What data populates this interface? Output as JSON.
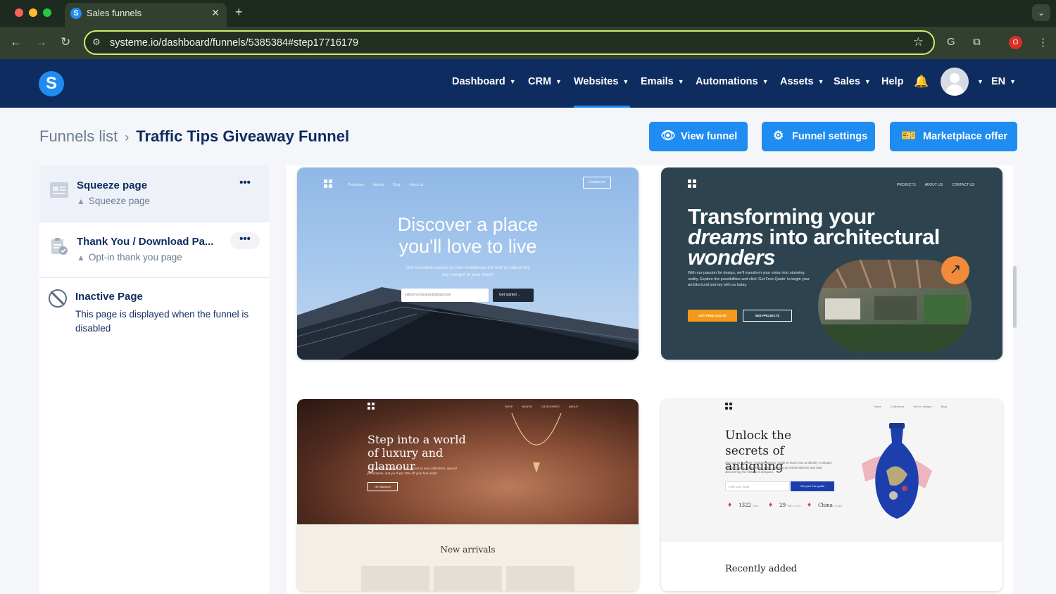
{
  "browser": {
    "tab_title": "Sales funnels",
    "new_tab": "+",
    "tab_close": "✕",
    "url": "systeme.io/dashboard/funnels/5385384#step17716179",
    "profile_badge": "O"
  },
  "app": {
    "logo_letter": "S",
    "nav": [
      {
        "label": "Dashboard",
        "active": false
      },
      {
        "label": "CRM",
        "active": false
      },
      {
        "label": "Websites",
        "active": true
      },
      {
        "label": "Emails",
        "active": false
      },
      {
        "label": "Automations",
        "active": false
      },
      {
        "label": "Assets",
        "active": false
      },
      {
        "label": "Sales",
        "active": false
      },
      {
        "label": "Help",
        "active": false
      }
    ],
    "language": "EN",
    "accent_color": "#1e8cf0",
    "header_color": "#0e2c5f"
  },
  "page": {
    "breadcrumb_parent": "Funnels list",
    "breadcrumb_current": "Traffic Tips Giveaway Funnel",
    "buttons": {
      "view_funnel": "View funnel",
      "funnel_settings": "Funnel settings",
      "marketplace_offer": "Marketplace offer"
    }
  },
  "steps": [
    {
      "title": "Squeeze page",
      "subtitle": "Squeeze page",
      "more": "•••",
      "active": true
    },
    {
      "title": "Thank You / Download Pa...",
      "subtitle": "Opt-in thank you page",
      "more": "•••",
      "active": false
    }
  ],
  "inactive_page": {
    "title": "Inactive Page",
    "description": "This page is displayed when the funnel is disabled"
  },
  "templates": [
    {
      "nav": [
        "Properties",
        "Agents",
        "Blog",
        "About us"
      ],
      "contact": "Contact us",
      "headline": "Discover a place you'll love to live",
      "sub": "Get exclusive access to new residences for rent or sale,every day straight to your inbox!",
      "email_placeholder": "valkoxni.missbay@gmail.com",
      "cta": "Get started →"
    },
    {
      "nav": [
        "PROJECTS",
        "ABOUT US",
        "CONTACT US"
      ],
      "headline_1": "Transforming your",
      "headline_2_em": "dreams",
      "headline_2": " into architectural",
      "headline_3_em": "wonders",
      "para": "With our passion for design, we'll transform your vision into stunning reality. Explore the possibilities and click 'Get Free Quote' to begin your architectural journey with us today.",
      "cta_1": "GET FREE QUOTE",
      "cta_2": "SEE PROJECTS",
      "arrow": "↗"
    },
    {
      "nav": [
        "SHOP",
        "NEW IN",
        "CATEGORIES",
        "ABOUT"
      ],
      "headline": "Step into a world of luxury and glamour",
      "sub": "Join our VIP email list for first access to new collections, special promotions, and you'll get 20% off your first order!",
      "cta": "Get discount",
      "section": "New arrivals"
    },
    {
      "nav": [
        "Home",
        "Collections",
        "Sell an antique",
        "Blog"
      ],
      "headline": "Unlock the secrets of antiquing",
      "sub": "Sign up for our free \"Antique Buying\" guide to learn how to identify, evaluate, and purchase antiques like a pro. Leave your email address and start discovering the history of antiques.",
      "email_placeholder": "Enter your email",
      "cta": "Get your free guide",
      "stats": [
        {
          "value": "1322",
          "label": "Year"
        },
        {
          "value": "29",
          "label": "Bids so far"
        },
        {
          "value": "China",
          "label": "Origin"
        }
      ],
      "section": "Recently added"
    }
  ]
}
